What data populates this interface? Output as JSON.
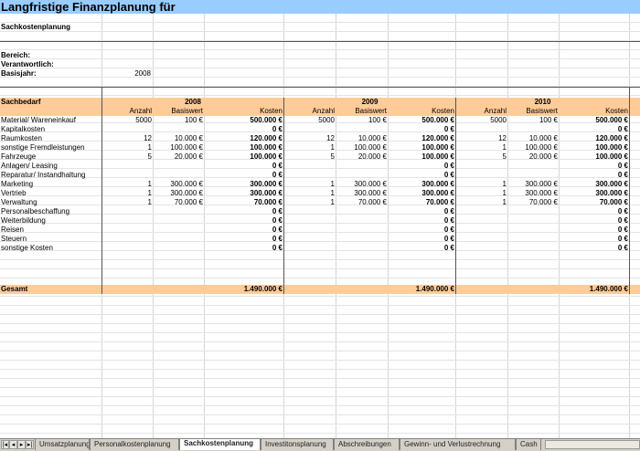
{
  "title": "Langfristige Finanzplanung für",
  "header": {
    "section": "Sachkostenplanung",
    "bereich_label": "Bereich:",
    "verantwortlich_label": "Verantwortlich:",
    "basisjahr_label": "Basisjahr:",
    "basisjahr_value": "2008"
  },
  "table": {
    "first_header": "Sachbedarf",
    "years": [
      "2008",
      "2009",
      "2010"
    ],
    "col_headers": [
      "Anzahl",
      "Basiswert",
      "Kosten"
    ],
    "rows": [
      {
        "label": "Material/ Wareneinkauf",
        "anzahl": "5000",
        "basis": "100 €",
        "kosten": "500.000 €"
      },
      {
        "label": "Kapitalkosten",
        "anzahl": "",
        "basis": "",
        "kosten": "0 €"
      },
      {
        "label": "Raumkosten",
        "anzahl": "12",
        "basis": "10.000 €",
        "kosten": "120.000 €"
      },
      {
        "label": "sonstige Fremdleistungen",
        "anzahl": "1",
        "basis": "100.000 €",
        "kosten": "100.000 €"
      },
      {
        "label": "Fahrzeuge",
        "anzahl": "5",
        "basis": "20.000 €",
        "kosten": "100.000 €"
      },
      {
        "label": "Anlagen/ Leasing",
        "anzahl": "",
        "basis": "",
        "kosten": "0 €"
      },
      {
        "label": "Reparatur/ Instandhaltung",
        "anzahl": "",
        "basis": "",
        "kosten": "0 €"
      },
      {
        "label": "Marketing",
        "anzahl": "1",
        "basis": "300.000 €",
        "kosten": "300.000 €"
      },
      {
        "label": "Vertrieb",
        "anzahl": "1",
        "basis": "300.000 €",
        "kosten": "300.000 €"
      },
      {
        "label": "Verwaltung",
        "anzahl": "1",
        "basis": "70.000 €",
        "kosten": "70.000 €"
      },
      {
        "label": "Personalbeschaffung",
        "anzahl": "",
        "basis": "",
        "kosten": "0 €"
      },
      {
        "label": "Weiterbildung",
        "anzahl": "",
        "basis": "",
        "kosten": "0 €"
      },
      {
        "label": "Reisen",
        "anzahl": "",
        "basis": "",
        "kosten": "0 €"
      },
      {
        "label": "Steuern",
        "anzahl": "",
        "basis": "",
        "kosten": "0 €"
      },
      {
        "label": "sonstige Kosten",
        "anzahl": "",
        "basis": "",
        "kosten": "0 €"
      }
    ],
    "total_label": "Gesamt",
    "totals": [
      "1.490.000 €",
      "1.490.000 €",
      "1.490.000 €"
    ]
  },
  "tabs": [
    {
      "label": "Umsatzplanung",
      "active": false
    },
    {
      "label": "Personalkostenplanung",
      "active": false
    },
    {
      "label": "Sachkostenplanung",
      "active": true
    },
    {
      "label": "Investitonsplanung",
      "active": false
    },
    {
      "label": "Abschreibungen",
      "active": false
    },
    {
      "label": "Gewinn- und Verlustrechnung",
      "active": false
    },
    {
      "label": "Cash",
      "active": false
    }
  ],
  "nav_icons": [
    "first-sheet-icon",
    "prev-sheet-icon",
    "next-sheet-icon",
    "last-sheet-icon"
  ]
}
